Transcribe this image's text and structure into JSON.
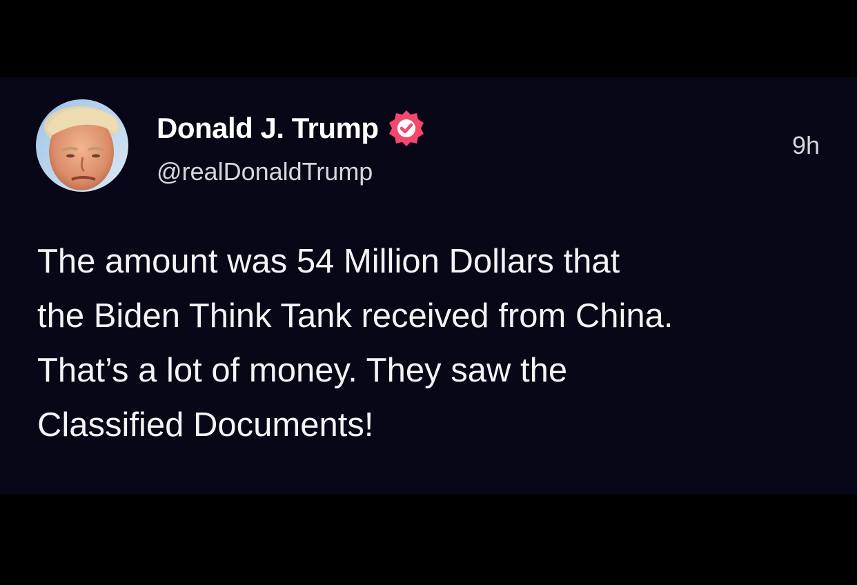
{
  "post": {
    "author": {
      "display_name": "Donald J. Trump",
      "handle": "@realDonaldTrump",
      "verified": true,
      "avatar_icon": "profile-photo-avatar",
      "badge_icon": "verified-badge-icon"
    },
    "timestamp": "9h",
    "body_lines": [
      "The amount was 54 Million Dollars that",
      "the Biden Think Tank received from China.",
      "That’s a lot of money. They saw the",
      "Classified Documents!"
    ]
  },
  "colors": {
    "page_background": "#000000",
    "card_background": "#080717",
    "text_primary": "#ffffff",
    "text_secondary": "#d6d6dc",
    "verified_badge": "#f4476f"
  }
}
